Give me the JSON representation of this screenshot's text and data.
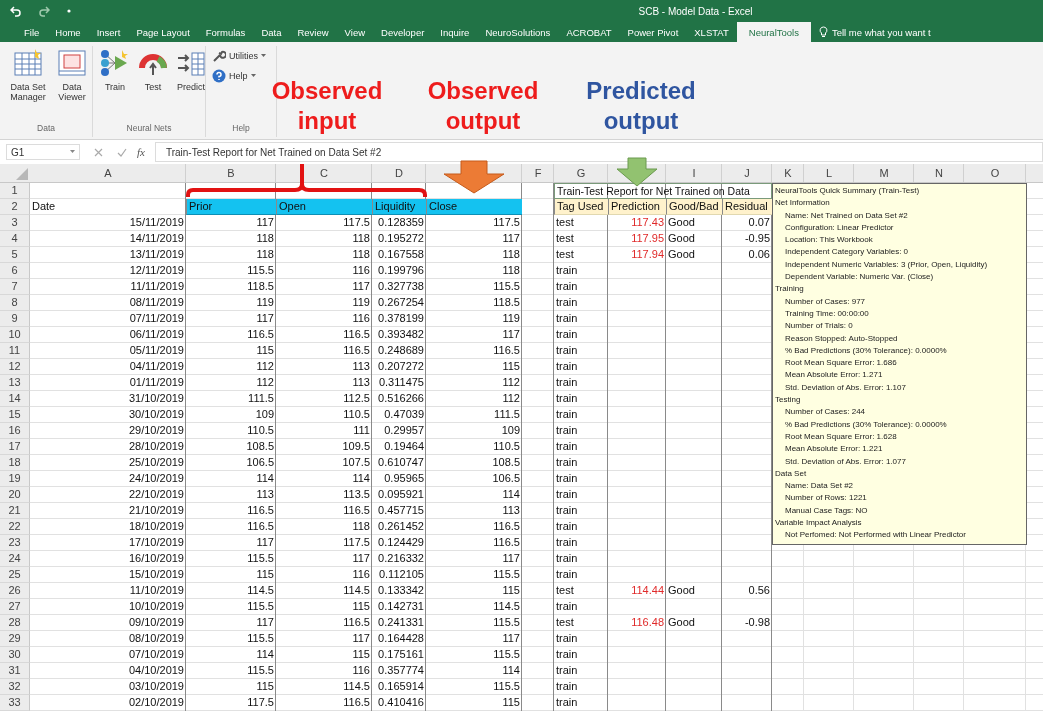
{
  "window": {
    "title": "SCB - Model Data - Excel"
  },
  "menu_tabs": [
    {
      "label": "File",
      "selected": false
    },
    {
      "label": "Home",
      "selected": false
    },
    {
      "label": "Insert",
      "selected": false
    },
    {
      "label": "Page Layout",
      "selected": false
    },
    {
      "label": "Formulas",
      "selected": false
    },
    {
      "label": "Data",
      "selected": false
    },
    {
      "label": "Review",
      "selected": false
    },
    {
      "label": "View",
      "selected": false
    },
    {
      "label": "Developer",
      "selected": false
    },
    {
      "label": "Inquire",
      "selected": false
    },
    {
      "label": "NeuroSolutions",
      "selected": false
    },
    {
      "label": "ACROBAT",
      "selected": false
    },
    {
      "label": "Power Pivot",
      "selected": false
    },
    {
      "label": "XLSTAT",
      "selected": false
    },
    {
      "label": "NeuralTools",
      "selected": true
    }
  ],
  "tell_me": "Tell me what you want t",
  "ribbon": {
    "groups": [
      {
        "name": "Data",
        "buttons": [
          {
            "label": "Data Set Manager",
            "kind": "grid"
          },
          {
            "label": "Data Viewer",
            "kind": "viewer"
          }
        ]
      },
      {
        "name": "Neural Nets",
        "buttons": [
          {
            "label": "Train",
            "kind": "train"
          },
          {
            "label": "Test",
            "kind": "test"
          },
          {
            "label": "Predict",
            "kind": "predict"
          }
        ]
      },
      {
        "name": "Help",
        "buttons": [
          {
            "label": "Utilities",
            "kind": "utilities"
          },
          {
            "label": "Help",
            "kind": "help"
          }
        ]
      }
    ]
  },
  "annotations": [
    {
      "text": "Observed input",
      "color": "#ee1c1c"
    },
    {
      "text": "Observed output",
      "color": "#ee1c1c"
    },
    {
      "text": "Predicted output",
      "color": "#2f55a0"
    }
  ],
  "sheet": {
    "name_box": "G1",
    "function_label": "fx",
    "formula": "Train-Test Report for Net Trained on Data Set #2",
    "columns_left": [
      "A",
      "B",
      "C",
      "D"
    ],
    "columns_middle": [
      "F",
      "G"
    ],
    "columns_right": [
      "I",
      "J",
      "K",
      "L",
      "M",
      "N",
      "O"
    ],
    "title_row": {
      "n": "1",
      "text": "Train-Test Report for Net Trained on Data"
    },
    "header_row": {
      "n": "2",
      "date": "Date",
      "inputs": [
        "Prior",
        "Open",
        "Liquidity",
        "Close"
      ],
      "report": [
        "Tag Used",
        "Prediction",
        "Good/Bad",
        "Residual"
      ]
    },
    "rows": [
      {
        "n": "3",
        "cells": [
          "15/11/2019",
          "117",
          "117.5",
          "0.128359",
          "117.5",
          "test",
          "117.43",
          "Good",
          "0.07"
        ]
      },
      {
        "n": "4",
        "cells": [
          "14/11/2019",
          "118",
          "118",
          "0.195272",
          "117",
          "test",
          "117.95",
          "Good",
          "-0.95"
        ]
      },
      {
        "n": "5",
        "cells": [
          "13/11/2019",
          "118",
          "118",
          "0.167558",
          "118",
          "test",
          "117.94",
          "Good",
          "0.06"
        ]
      },
      {
        "n": "6",
        "cells": [
          "12/11/2019",
          "115.5",
          "116",
          "0.199796",
          "118",
          "train"
        ]
      },
      {
        "n": "7",
        "cells": [
          "11/11/2019",
          "118.5",
          "117",
          "0.327738",
          "115.5",
          "train"
        ]
      },
      {
        "n": "8",
        "cells": [
          "08/11/2019",
          "119",
          "119",
          "0.267254",
          "118.5",
          "train"
        ]
      },
      {
        "n": "9",
        "cells": [
          "07/11/2019",
          "117",
          "116",
          "0.378199",
          "119",
          "train"
        ]
      },
      {
        "n": "10",
        "cells": [
          "06/11/2019",
          "116.5",
          "116.5",
          "0.393482",
          "117",
          "train"
        ]
      },
      {
        "n": "11",
        "cells": [
          "05/11/2019",
          "115",
          "116.5",
          "0.248689",
          "116.5",
          "train"
        ]
      },
      {
        "n": "12",
        "cells": [
          "04/11/2019",
          "112",
          "113",
          "0.207272",
          "115",
          "train"
        ]
      },
      {
        "n": "13",
        "cells": [
          "01/11/2019",
          "112",
          "113",
          "0.311475",
          "112",
          "train"
        ]
      },
      {
        "n": "14",
        "cells": [
          "31/10/2019",
          "111.5",
          "112.5",
          "0.516266",
          "112",
          "train"
        ]
      },
      {
        "n": "15",
        "cells": [
          "30/10/2019",
          "109",
          "110.5",
          "0.47039",
          "111.5",
          "train"
        ]
      },
      {
        "n": "16",
        "cells": [
          "29/10/2019",
          "110.5",
          "111",
          "0.29957",
          "109",
          "train"
        ]
      },
      {
        "n": "17",
        "cells": [
          "28/10/2019",
          "108.5",
          "109.5",
          "0.19464",
          "110.5",
          "train"
        ]
      },
      {
        "n": "18",
        "cells": [
          "25/10/2019",
          "106.5",
          "107.5",
          "0.610747",
          "108.5",
          "train"
        ]
      },
      {
        "n": "19",
        "cells": [
          "24/10/2019",
          "114",
          "114",
          "0.95965",
          "106.5",
          "train"
        ]
      },
      {
        "n": "20",
        "cells": [
          "22/10/2019",
          "113",
          "113.5",
          "0.095921",
          "114",
          "train"
        ]
      },
      {
        "n": "21",
        "cells": [
          "21/10/2019",
          "116.5",
          "116.5",
          "0.457715",
          "113",
          "train"
        ]
      },
      {
        "n": "22",
        "cells": [
          "18/10/2019",
          "116.5",
          "118",
          "0.261452",
          "116.5",
          "train"
        ]
      },
      {
        "n": "23",
        "cells": [
          "17/10/2019",
          "117",
          "117.5",
          "0.124429",
          "116.5",
          "train"
        ]
      },
      {
        "n": "24",
        "cells": [
          "16/10/2019",
          "115.5",
          "117",
          "0.216332",
          "117",
          "train"
        ]
      },
      {
        "n": "25",
        "cells": [
          "15/10/2019",
          "115",
          "116",
          "0.112105",
          "115.5",
          "train"
        ]
      },
      {
        "n": "26",
        "cells": [
          "11/10/2019",
          "114.5",
          "114.5",
          "0.133342",
          "115",
          "test",
          "114.44",
          "Good",
          "0.56"
        ]
      },
      {
        "n": "27",
        "cells": [
          "10/10/2019",
          "115.5",
          "115",
          "0.142731",
          "114.5",
          "train"
        ]
      },
      {
        "n": "28",
        "cells": [
          "09/10/2019",
          "117",
          "116.5",
          "0.241331",
          "115.5",
          "test",
          "116.48",
          "Good",
          "-0.98"
        ]
      },
      {
        "n": "29",
        "cells": [
          "08/10/2019",
          "115.5",
          "117",
          "0.164428",
          "117",
          "train"
        ]
      },
      {
        "n": "30",
        "cells": [
          "07/10/2019",
          "114",
          "115",
          "0.175161",
          "115.5",
          "train"
        ]
      },
      {
        "n": "31",
        "cells": [
          "04/10/2019",
          "115.5",
          "116",
          "0.357774",
          "114",
          "train"
        ]
      },
      {
        "n": "32",
        "cells": [
          "03/10/2019",
          "115",
          "114.5",
          "0.165914",
          "115.5",
          "train"
        ]
      },
      {
        "n": "33",
        "cells": [
          "02/10/2019",
          "117.5",
          "116.5",
          "0.410416",
          "115",
          "train"
        ]
      }
    ]
  },
  "summary": {
    "title": "NeuralTools Quick Summary (Train-Test)",
    "sections": [
      {
        "heading": "Net Information",
        "lines": [
          "Name: Net Trained on Data Set #2",
          "Configuration: Linear Predictor",
          "Location: This Workbook",
          "Independent Category Variables: 0",
          "Independent Numeric Variables: 3 (Prior, Open, Liquidity)",
          "Dependent Variable: Numeric Var. (Close)"
        ]
      },
      {
        "heading": "Training",
        "lines": [
          "Number of Cases: 977",
          "Training Time: 00:00:00",
          "Number of Trials: 0",
          "Reason Stopped: Auto-Stopped",
          "% Bad Predictions (30% Tolerance): 0.0000%",
          "Root Mean Square Error: 1.686",
          "Mean Absolute Error: 1.271",
          "Std. Deviation of Abs. Error: 1.107"
        ]
      },
      {
        "heading": "Testing",
        "lines": [
          "Number of Cases: 244",
          "% Bad Predictions (30% Tolerance): 0.0000%",
          "Root Mean Square Error: 1.628",
          "Mean Absolute Error: 1.221",
          "Std. Deviation of Abs. Error: 1.077"
        ]
      },
      {
        "heading": "Data Set",
        "lines": [
          "Name: Data Set #2",
          "Number of Rows: 1221",
          "Manual Case Tags: NO"
        ]
      },
      {
        "heading": "Variable Impact Analysis",
        "lines": [
          "Not Perfomed: Not Performed with Linear Predictor"
        ]
      }
    ]
  }
}
